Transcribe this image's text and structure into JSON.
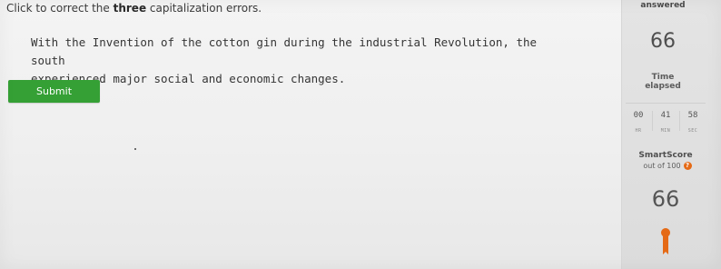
{
  "question": {
    "instructions_prefix": "Click to correct the ",
    "instructions_emphasis": "three",
    "instructions_suffix": " capitalization errors.",
    "sentence_words": [
      "With",
      "the",
      "Invention",
      "of",
      "the",
      "cotton",
      "gin",
      "during",
      "the",
      "industrial",
      "Revolution,",
      "the",
      "south",
      "experienced",
      "major",
      "social",
      "and",
      "economic",
      "changes."
    ]
  },
  "submit": {
    "label": "Submit"
  },
  "sidebar": {
    "answered_label": "answered",
    "answered_count": "66",
    "time_label_line1": "Time",
    "time_label_line2": "elapsed",
    "timer": {
      "hours": "00",
      "minutes": "41",
      "seconds": "58",
      "hours_unit": "HR",
      "minutes_unit": "MIN",
      "seconds_unit": "SEC"
    },
    "smartscore_label": "SmartScore",
    "out_of_label": "out of 100",
    "info_glyph": "?",
    "smartscore_value": "66",
    "medal_icon": "medal-icon",
    "accent_color": "#e56a16",
    "submit_color": "#35a035"
  }
}
